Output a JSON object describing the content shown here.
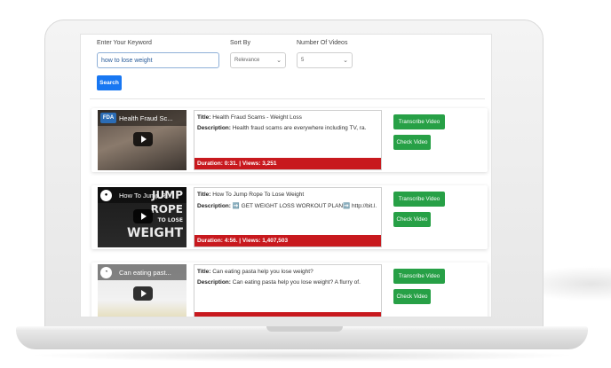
{
  "search_form": {
    "keyword_label": "Enter Your Keyword",
    "keyword_value": "how to lose weight",
    "sort_label": "Sort By",
    "sort_value": "Relevance",
    "number_label": "Number Of Videos",
    "number_value": "5",
    "search_button": "Search"
  },
  "labels": {
    "title_prefix": "Title:",
    "description_prefix": "Description:",
    "transcribe_button": "Transcribe Video",
    "check_button": "Check Video"
  },
  "videos": [
    {
      "thumb_logo": "FDA",
      "thumb_title": "Health Fraud Sc...",
      "title": "Health Fraud Scams - Weight Loss",
      "description": "Health fraud scams are everywhere including TV, ra.",
      "meta": "Duration: 0:31. | Views: 3,251"
    },
    {
      "thumb_title": "How To Jump R...",
      "thumb_words": [
        "JUMP",
        "ROPE",
        "TO LOSE",
        "WEIGHT"
      ],
      "title": "How To Jump Rope To Lose Weight",
      "description": "➡️ GET WEIGHT LOSS WORKOUT PLAN➡️ http://bit.l.",
      "meta": "Duration: 4:56. | Views: 1,407,503"
    },
    {
      "thumb_title": "Can eating past...",
      "title": "Can eating pasta help you lose weight?",
      "description": "Can eating pasta help you lose weight? A flurry of.",
      "meta": ""
    }
  ],
  "colors": {
    "primary": "#1877f2",
    "success": "#27a046",
    "danger": "#c8191e"
  }
}
